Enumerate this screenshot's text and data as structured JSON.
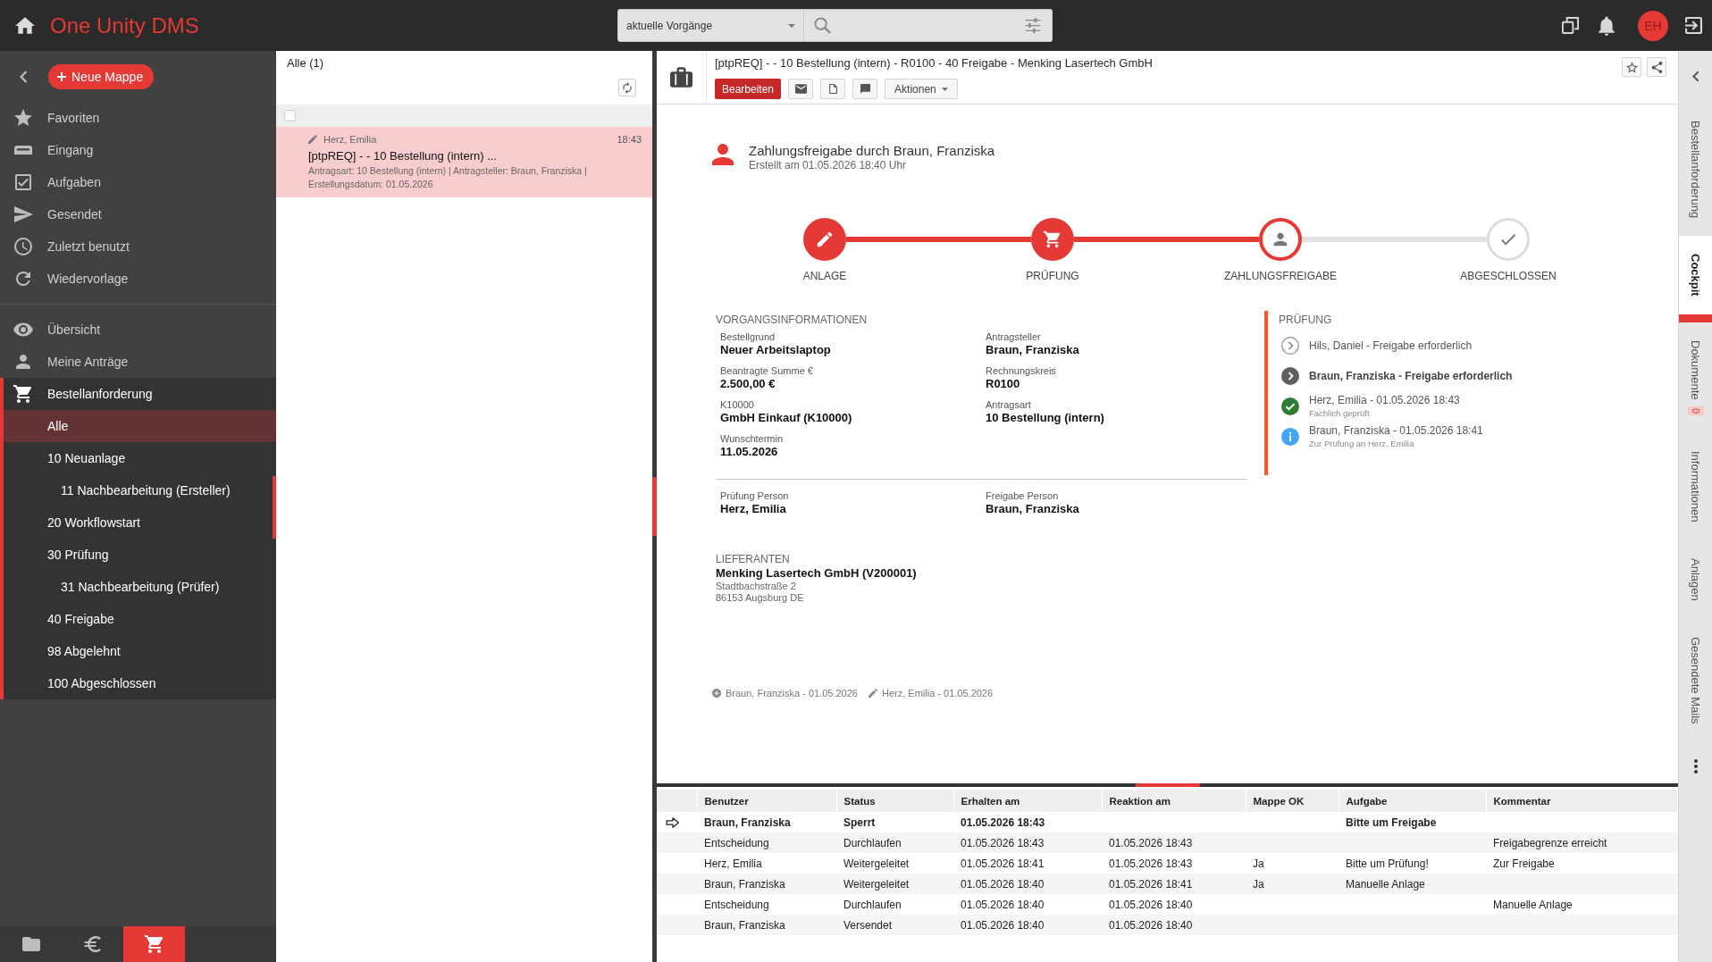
{
  "app": {
    "title": "One Unity DMS"
  },
  "search": {
    "scope": "aktuelle Vorgänge"
  },
  "user": {
    "initials": "EH"
  },
  "sidebar": {
    "new_button": "Neue Mappe",
    "primary": [
      {
        "label": "Favoriten",
        "selected": false
      },
      {
        "label": "Eingang",
        "selected": false
      },
      {
        "label": "Aufgaben",
        "selected": false
      },
      {
        "label": "Gesendet",
        "selected": false
      },
      {
        "label": "Zuletzt benutzt",
        "selected": false
      },
      {
        "label": "Wiedervorlage",
        "selected": false
      }
    ],
    "secondary": [
      {
        "label": "Übersicht",
        "selected": false,
        "expanded": false
      },
      {
        "label": "Meine Anträge",
        "selected": false,
        "expanded": false
      },
      {
        "label": "Bestellanforderung",
        "selected": false,
        "expanded": true,
        "children": [
          {
            "label": "Alle",
            "selected": true
          },
          {
            "label": "10 Neuanlage",
            "selected": false,
            "children": [
              {
                "label": "11 Nachbearbeitung (Ersteller)",
                "selected": false
              }
            ]
          },
          {
            "label": "20 Workflowstart",
            "selected": false
          },
          {
            "label": "30 Prüfung",
            "selected": false,
            "children": [
              {
                "label": "31 Nachbearbeitung (Prüfer)",
                "selected": false
              }
            ]
          },
          {
            "label": "40 Freigabe",
            "selected": false
          },
          {
            "label": "98 Abgelehnt",
            "selected": false
          },
          {
            "label": "100 Abgeschlossen",
            "selected": false
          }
        ]
      }
    ],
    "bottom_tabs": [
      {
        "selected": false
      },
      {
        "selected": false
      },
      {
        "selected": true
      }
    ]
  },
  "list": {
    "title": "Alle (1)",
    "select_all": {
      "checked": false
    },
    "items": [
      {
        "author": "Herz, Emilia",
        "time": "18:43",
        "title": "[ptpREQ] - - 10 Bestellung (intern) ...",
        "details": "Antragsart: 10 Bestellung (intern) | Antragsteller: Braun, Franziska | Erstellungsdatum: 01.05.2026",
        "selected": true
      }
    ]
  },
  "detail": {
    "title": "[ptpREQ] - - 10 Bestellung (intern) - R0100 - 40 Freigabe - Menking Lasertech GmbH",
    "edit_button": "Bearbeiten",
    "actions_button": "Aktionen"
  },
  "cockpit": {
    "heading": "Zahlungsfreigabe durch Braun, Franziska",
    "subheading": "Erstellt am 01.05.2026 18:40 Uhr",
    "steps": [
      {
        "label": "ANLAGE",
        "done": true,
        "current": false
      },
      {
        "label": "PRÜFUNG",
        "done": true,
        "current": false
      },
      {
        "label": "ZAHLUNGSFREIGABE",
        "done": false,
        "current": true
      },
      {
        "label": "ABGESCHLOSSEN",
        "done": false,
        "current": false
      }
    ],
    "info": {
      "title": "VORGANGSINFORMATIONEN",
      "columns": [
        [
          {
            "label": "Bestellgrund",
            "value": "Neuer Arbeitslaptop"
          },
          {
            "label": "Beantragte Summe €",
            "value": "2.500,00 €"
          },
          {
            "label": "K10000",
            "value": "GmbH Einkauf (K10000)"
          },
          {
            "label": "Wunschtermin",
            "value": "11.05.2026"
          }
        ],
        [
          {
            "label": "Antragsteller",
            "value": "Braun, Franziska"
          },
          {
            "label": "Rechnungskreis",
            "value": "R0100"
          },
          {
            "label": "Antragsart",
            "value": "10 Bestellung (intern)"
          }
        ]
      ],
      "persons": [
        {
          "label": "Prüfung Person",
          "value": "Herz, Emilia"
        },
        {
          "label": "Freigabe Person",
          "value": "Braun, Franziska"
        }
      ]
    },
    "review": {
      "title": "PRÜFUNG",
      "entries": [
        {
          "kind": "pending",
          "text": "Hils, Daniel - Freigabe erforderlich"
        },
        {
          "kind": "current",
          "text": "Braun, Franziska - Freigabe erforderlich"
        },
        {
          "kind": "done",
          "text": "Herz, Emilia - 01.05.2026 18:43",
          "note": "Fachlich geprüft"
        },
        {
          "kind": "info",
          "text": "Braun, Franziska - 01.05.2026 18:41",
          "note": "Zur Prüfung an Herz, Emilia"
        }
      ]
    },
    "supplier": {
      "title": "LIEFERANTEN",
      "name": "Menking Lasertech GmbH (V200001)",
      "address": [
        "Stadtbachstraße 2",
        "86153 Augsburg DE"
      ]
    },
    "history": [
      {
        "kind": "created",
        "text": "Braun, Franziska - 01.05.2026"
      },
      {
        "kind": "edited",
        "text": "Herz, Emilia - 01.05.2026"
      }
    ]
  },
  "workflow_table": {
    "columns": [
      "Benutzer",
      "Status",
      "Erhalten am",
      "Reaktion am",
      "Mappe OK",
      "Aufgabe",
      "Kommentar"
    ],
    "rows": [
      {
        "current": true,
        "user": "Braun, Franziska",
        "status": "Sperrt",
        "received": "01.05.2026 18:43",
        "task": "Bitte um Freigabe"
      },
      {
        "current": false,
        "user": "Entscheidung",
        "status": "Durchlaufen",
        "received": "01.05.2026 18:43",
        "reaction": "01.05.2026 18:43",
        "comment": "Freigabegrenze erreicht"
      },
      {
        "current": false,
        "user": "Herz, Emilia",
        "status": "Weitergeleitet",
        "received": "01.05.2026 18:41",
        "reaction": "01.05.2026 18:43",
        "folder_ok": "Ja",
        "task": "Bitte um Prüfung!",
        "comment": "Zur Freigabe"
      },
      {
        "current": false,
        "user": "Braun, Franziska",
        "status": "Weitergeleitet",
        "received": "01.05.2026 18:40",
        "reaction": "01.05.2026 18:41",
        "folder_ok": "Ja",
        "task": "Manuelle Anlage"
      },
      {
        "current": false,
        "user": "Entscheidung",
        "status": "Durchlaufen",
        "received": "01.05.2026 18:40",
        "reaction": "01.05.2026 18:40",
        "comment": "Manuelle Anlage"
      },
      {
        "current": false,
        "user": "Braun, Franziska",
        "status": "Versendet",
        "received": "01.05.2026 18:40",
        "reaction": "01.05.2026 18:40"
      }
    ]
  },
  "side_tabs": [
    {
      "label": "Bestellanforderung",
      "selected": false
    },
    {
      "label": "Cockpit",
      "selected": true
    },
    {
      "label": "Dokumente",
      "selected": false,
      "badge": "0"
    },
    {
      "label": "Informationen",
      "selected": false
    },
    {
      "label": "Anlagen",
      "selected": false
    },
    {
      "label": "Gesendete Mails",
      "selected": false
    }
  ]
}
